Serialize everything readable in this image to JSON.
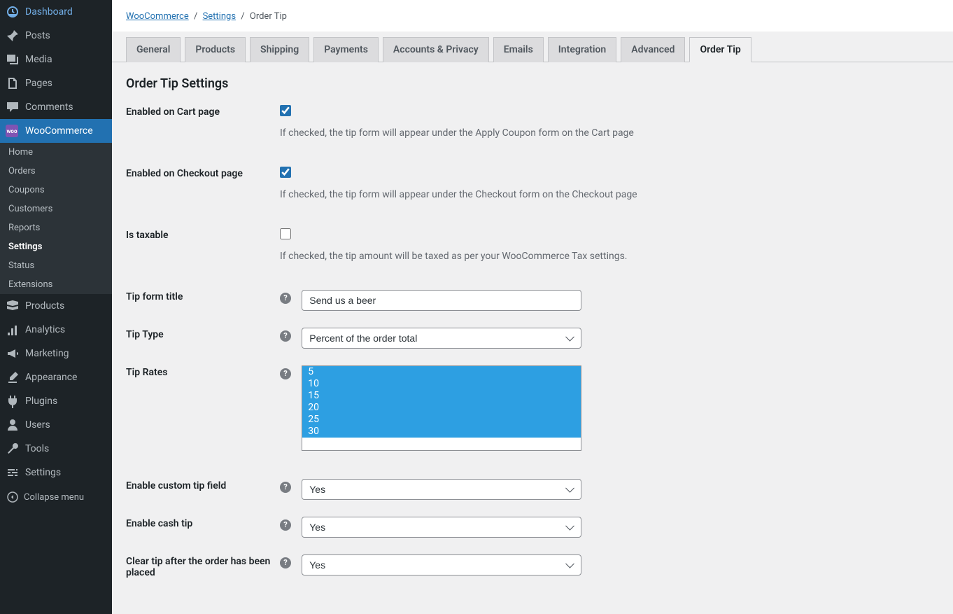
{
  "sidebar": {
    "items": [
      {
        "key": "dashboard",
        "label": "Dashboard"
      },
      {
        "key": "posts",
        "label": "Posts"
      },
      {
        "key": "media",
        "label": "Media"
      },
      {
        "key": "pages",
        "label": "Pages"
      },
      {
        "key": "comments",
        "label": "Comments"
      },
      {
        "key": "woocommerce",
        "label": "WooCommerce"
      },
      {
        "key": "products",
        "label": "Products"
      },
      {
        "key": "analytics",
        "label": "Analytics"
      },
      {
        "key": "marketing",
        "label": "Marketing"
      },
      {
        "key": "appearance",
        "label": "Appearance"
      },
      {
        "key": "plugins",
        "label": "Plugins"
      },
      {
        "key": "users",
        "label": "Users"
      },
      {
        "key": "tools",
        "label": "Tools"
      },
      {
        "key": "settings",
        "label": "Settings"
      }
    ],
    "woocommerce_sub": [
      {
        "label": "Home"
      },
      {
        "label": "Orders"
      },
      {
        "label": "Coupons"
      },
      {
        "label": "Customers"
      },
      {
        "label": "Reports"
      },
      {
        "label": "Settings",
        "current": true
      },
      {
        "label": "Status"
      },
      {
        "label": "Extensions"
      }
    ],
    "collapse_label": "Collapse menu"
  },
  "breadcrumb": {
    "woocommerce": "WooCommerce",
    "settings": "Settings",
    "current": "Order Tip"
  },
  "tabs": [
    {
      "label": "General"
    },
    {
      "label": "Products"
    },
    {
      "label": "Shipping"
    },
    {
      "label": "Payments"
    },
    {
      "label": "Accounts & Privacy"
    },
    {
      "label": "Emails"
    },
    {
      "label": "Integration"
    },
    {
      "label": "Advanced"
    },
    {
      "label": "Order Tip",
      "active": true
    }
  ],
  "page_title": "Order Tip Settings",
  "fields": {
    "enabled_cart": {
      "label": "Enabled on Cart page",
      "checked": true,
      "desc": "If checked, the tip form will appear under the Apply Coupon form on the Cart page"
    },
    "enabled_checkout": {
      "label": "Enabled on Checkout page",
      "checked": true,
      "desc": "If checked, the tip form will appear under the Checkout form on the Checkout page"
    },
    "is_taxable": {
      "label": "Is taxable",
      "checked": false,
      "desc": "If checked, the tip amount will be taxed as per your WooCommerce Tax settings."
    },
    "form_title": {
      "label": "Tip form title",
      "value": "Send us a beer"
    },
    "tip_type": {
      "label": "Tip Type",
      "value": "Percent of the order total"
    },
    "tip_rates": {
      "label": "Tip Rates",
      "options": [
        "5",
        "10",
        "15",
        "20",
        "25",
        "30"
      ]
    },
    "custom_tip": {
      "label": "Enable custom tip field",
      "value": "Yes"
    },
    "cash_tip": {
      "label": "Enable cash tip",
      "value": "Yes"
    },
    "clear_tip": {
      "label": "Clear tip after the order has been placed",
      "value": "Yes"
    }
  }
}
